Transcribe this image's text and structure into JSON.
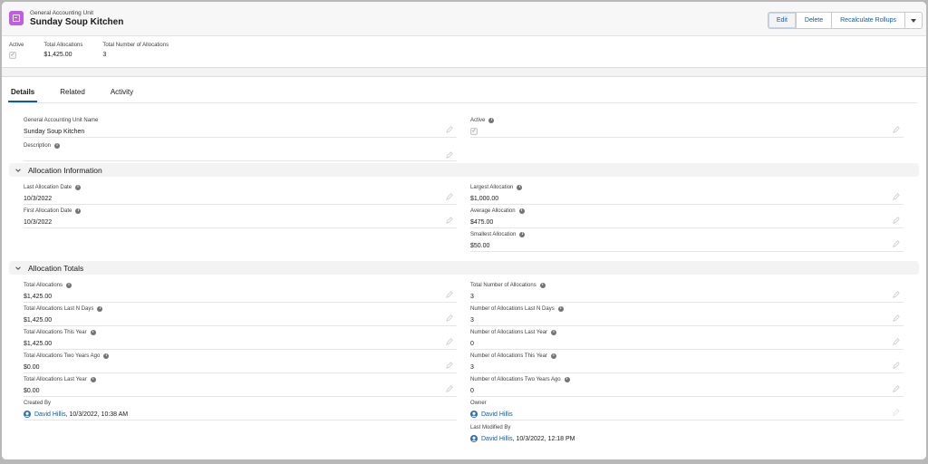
{
  "header": {
    "object_type": "General Accounting Unit",
    "record_name": "Sunday Soup Kitchen",
    "buttons": {
      "edit": "Edit",
      "delete": "Delete",
      "recalculate": "Recalculate Rollups"
    }
  },
  "highlights": {
    "active_label": "Active",
    "total_alloc_label": "Total Allocations",
    "total_alloc_value": "$1,425.00",
    "total_num_label": "Total Number of Allocations",
    "total_num_value": "3"
  },
  "tabs": {
    "details": "Details",
    "related": "Related",
    "activity": "Activity"
  },
  "details": {
    "gau_name_label": "General Accounting Unit Name",
    "gau_name_value": "Sunday Soup Kitchen",
    "description_label": "Description",
    "active_label": "Active"
  },
  "sections": {
    "alloc_info": "Allocation Information",
    "alloc_totals": "Allocation Totals"
  },
  "alloc_info": {
    "last_date_label": "Last Allocation Date",
    "last_date_value": "10/3/2022",
    "first_date_label": "First Allocation Date",
    "first_date_value": "10/3/2022",
    "largest_label": "Largest Allocation",
    "largest_value": "$1,000.00",
    "average_label": "Average Allocation",
    "average_value": "$475.00",
    "smallest_label": "Smallest Allocation",
    "smallest_value": "$50.00"
  },
  "totals": {
    "left": [
      {
        "label": "Total Allocations",
        "value": "$1,425.00"
      },
      {
        "label": "Total Allocations Last N Days",
        "value": "$1,425.00"
      },
      {
        "label": "Total Allocations This Year",
        "value": "$1,425.00"
      },
      {
        "label": "Total Allocations Two Years Ago",
        "value": "$0.00"
      },
      {
        "label": "Total Allocations Last Year",
        "value": "$0.00"
      }
    ],
    "right": [
      {
        "label": "Total Number of Allocations",
        "value": "3"
      },
      {
        "label": "Number of Allocations Last N Days",
        "value": "3"
      },
      {
        "label": "Number of Allocations Last Year",
        "value": "0"
      },
      {
        "label": "Number of Allocations This Year",
        "value": "3"
      },
      {
        "label": "Number of Allocations Two Years Ago",
        "value": "0"
      }
    ]
  },
  "system": {
    "created_by_label": "Created By",
    "created_by_user": "David Hillis",
    "created_by_date": ", 10/3/2022, 10:38 AM",
    "owner_label": "Owner",
    "owner_user": "David Hillis",
    "modified_label": "Last Modified By",
    "modified_user": "David Hillis",
    "modified_date": ", 10/3/2022, 12:18 PM"
  },
  "colors": {
    "brand": "#0b5cab",
    "object_icon": "#c25ce0",
    "section_bg": "#f3f3f3"
  },
  "icons": {
    "object": "gau-icon",
    "info": "info-icon",
    "edit": "pencil-icon",
    "chevron": "chevron-down-icon",
    "avatar": "user-avatar-icon"
  }
}
